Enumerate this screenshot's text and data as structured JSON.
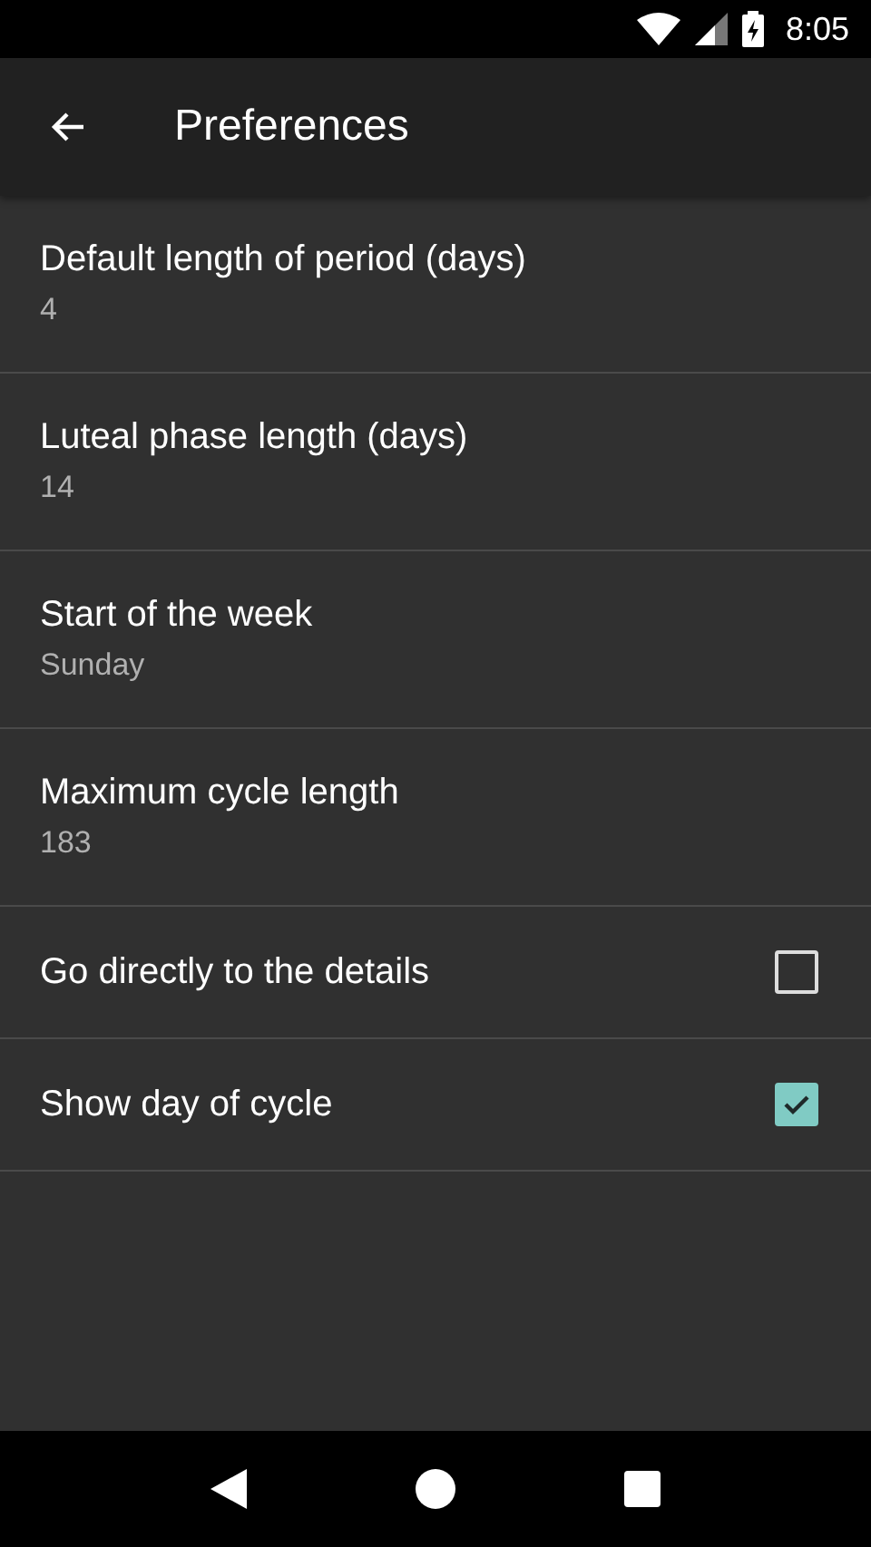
{
  "status_bar": {
    "time": "8:05"
  },
  "toolbar": {
    "title": "Preferences"
  },
  "preferences": [
    {
      "kind": "summary",
      "title": "Default length of period (days)",
      "summary": "4"
    },
    {
      "kind": "summary",
      "title": "Luteal phase length (days)",
      "summary": "14"
    },
    {
      "kind": "summary",
      "title": "Start of the week",
      "summary": "Sunday"
    },
    {
      "kind": "summary",
      "title": "Maximum cycle length",
      "summary": "183"
    },
    {
      "kind": "checkbox",
      "title": "Go directly to the details",
      "checked": false
    },
    {
      "kind": "checkbox",
      "title": "Show day of cycle",
      "checked": true
    }
  ]
}
